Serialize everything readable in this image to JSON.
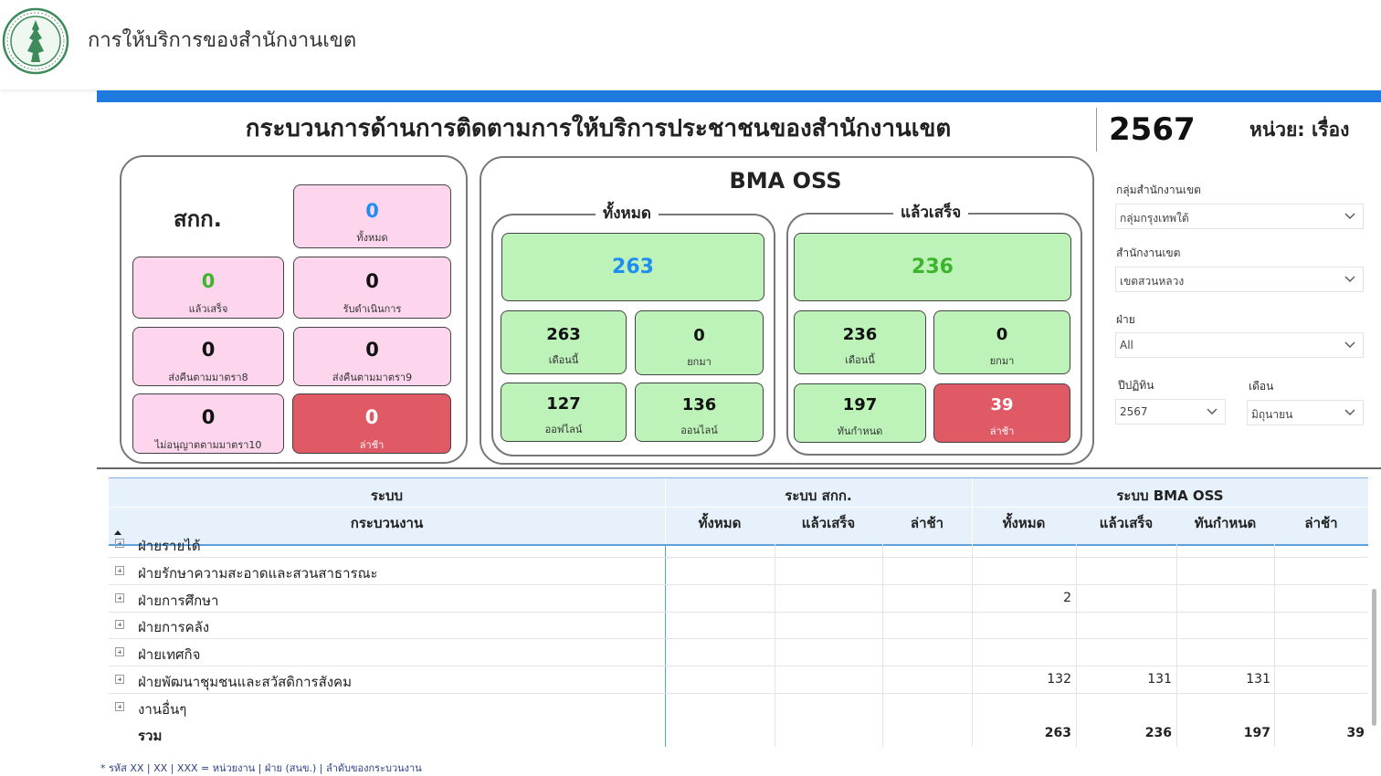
{
  "header": {
    "app_title": "การให้บริการของสำนักงานเขต",
    "logo_icon": "bangkok-seal-logo"
  },
  "report": {
    "title": "กระบวนการด้านการติดตามการให้บริการประชาชนของสำนักงานเขต",
    "year": "2567",
    "unit": "หน่วย: เรื่อง"
  },
  "skk": {
    "title": "สกก.",
    "total": {
      "value": "0",
      "label": "ทั้งหมด"
    },
    "done": {
      "value": "0",
      "label": "แล้วเสร็จ"
    },
    "in_progress": {
      "value": "0",
      "label": "รับดำเนินการ"
    },
    "return8": {
      "value": "0",
      "label": "ส่งคืนตามมาตรา8"
    },
    "return9": {
      "value": "0",
      "label": "ส่งคืนตามมาตรา9"
    },
    "deny10": {
      "value": "0",
      "label": "ไม่อนุญาตตามมาตรา10"
    },
    "late": {
      "value": "0",
      "label": "ล่าช้า"
    }
  },
  "oss": {
    "title": "BMA OSS",
    "all": {
      "title": "ทั้งหมด",
      "total": "263",
      "this_month": {
        "value": "263",
        "label": "เดือนนี้"
      },
      "carried": {
        "value": "0",
        "label": "ยกมา"
      },
      "offline": {
        "value": "127",
        "label": "ออฟไลน์"
      },
      "online": {
        "value": "136",
        "label": "ออนไลน์"
      }
    },
    "done": {
      "title": "แล้วเสร็จ",
      "total": "236",
      "this_month": {
        "value": "236",
        "label": "เดือนนี้"
      },
      "carried": {
        "value": "0",
        "label": "ยกมา"
      },
      "on_time": {
        "value": "197",
        "label": "ทันกำหนด"
      },
      "late": {
        "value": "39",
        "label": "ล่าช้า"
      }
    }
  },
  "filters": {
    "district_group": {
      "label": "กลุ่มสำนักงานเขต",
      "value": "กลุ่มกรุงเทพใต้"
    },
    "district": {
      "label": "สำนักงานเขต",
      "value": "เขตสวนหลวง"
    },
    "division": {
      "label": "ฝ่าย",
      "value": "All"
    },
    "fiscal_year": {
      "label": "ปีปฏิทิน",
      "value": "2567"
    },
    "month": {
      "label": "เดือน",
      "value": "มิถุนายน"
    }
  },
  "table": {
    "group_system": "ระบบ",
    "group_skk": "ระบบ สกก.",
    "group_oss": "ระบบ BMA OSS",
    "col_process": "กระบวนงาน",
    "skk_cols": [
      "ทั้งหมด",
      "แล้วเสร็จ",
      "ล่าช้า"
    ],
    "oss_cols": [
      "ทั้งหมด",
      "แล้วเสร็จ",
      "ทันกำหนด",
      "ล่าช้า"
    ],
    "rows": [
      {
        "name": "ฝ่ายรายได้",
        "oss_total": "",
        "oss_done": "",
        "oss_ontime": "",
        "oss_late": ""
      },
      {
        "name": "ฝ่ายรักษาความสะอาดและสวนสาธารณะ",
        "oss_total": "",
        "oss_done": "",
        "oss_ontime": "",
        "oss_late": ""
      },
      {
        "name": "ฝ่ายการศึกษา",
        "oss_total": "2",
        "oss_done": "",
        "oss_ontime": "",
        "oss_late": ""
      },
      {
        "name": "ฝ่ายการคลัง",
        "oss_total": "",
        "oss_done": "",
        "oss_ontime": "",
        "oss_late": ""
      },
      {
        "name": "ฝ่ายเทศกิจ",
        "oss_total": "",
        "oss_done": "",
        "oss_ontime": "",
        "oss_late": ""
      },
      {
        "name": "ฝ่ายพัฒนาชุมชนและสวัสดิการสังคม",
        "oss_total": "132",
        "oss_done": "131",
        "oss_ontime": "131",
        "oss_late": ""
      },
      {
        "name": "งานอื่นๆ",
        "oss_total": "",
        "oss_done": "",
        "oss_ontime": "",
        "oss_late": ""
      }
    ],
    "total": {
      "name": "รวม",
      "oss_total": "263",
      "oss_done": "236",
      "oss_ontime": "197",
      "oss_late": "39"
    }
  },
  "footnote": "* รหัส XX | XX | XXX = หน่วยงาน | ฝ่าย (สนข.) | ลำดับของกระบวนงาน"
}
